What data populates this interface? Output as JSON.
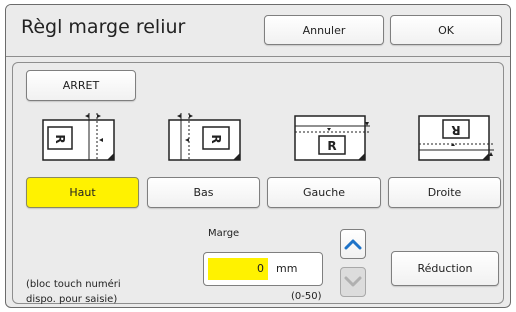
{
  "header": {
    "title": "Règl marge reliur",
    "cancel_label": "Annuler",
    "ok_label": "OK"
  },
  "off_button": {
    "label": "ARRET"
  },
  "positions": {
    "selected": "Haut",
    "items": [
      {
        "id": "top",
        "label": "Haut"
      },
      {
        "id": "bottom",
        "label": "Bas"
      },
      {
        "id": "left",
        "label": "Gauche"
      },
      {
        "id": "right",
        "label": "Droite"
      }
    ]
  },
  "margin": {
    "label": "Marge",
    "value": "0",
    "unit": "mm",
    "range": "(0-50)"
  },
  "hint": {
    "line1": "(bloc touch numéri",
    "line2": "dispo. pour saisie)"
  },
  "reduction": {
    "label": "Réduction"
  },
  "colors": {
    "selected": "#fff200",
    "up_arrow": "#1e73c8",
    "down_arrow_disabled": "#b0b0b0"
  },
  "icons": {
    "up": "chevron-up-icon",
    "down": "chevron-down-icon"
  }
}
